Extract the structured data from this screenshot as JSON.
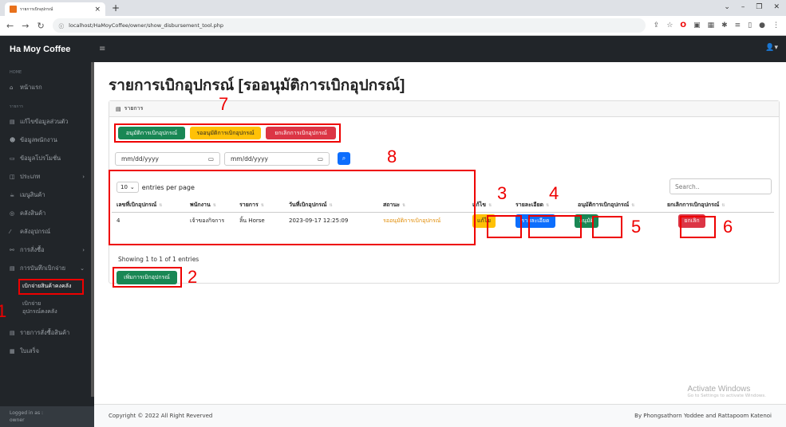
{
  "browser": {
    "tab_title": "รายการเบิกอุปกรณ์",
    "url": "localhost/HaMoyCoffee/owner/show_disbursement_tool.php"
  },
  "app": {
    "brand": "Ha Moy Coffee",
    "logged_in_label": "Logged in as :",
    "logged_in_user": "owner"
  },
  "sidebar": {
    "section_home": "HOME",
    "home": "หน้าแรก",
    "section_list": "รายการ",
    "items": [
      {
        "label": "แก้ไขข้อมูลส่วนตัว",
        "icon": "id-card-icon"
      },
      {
        "label": "ข้อมูลพนักงาน",
        "icon": "users-icon"
      },
      {
        "label": "ข้อมูลโปรโมชั่น",
        "icon": "tag-icon"
      },
      {
        "label": "ประเภท",
        "icon": "grid-icon"
      },
      {
        "label": "เมนูสินค้า",
        "icon": "cup-icon"
      },
      {
        "label": "คลังสินค้า",
        "icon": "box-icon"
      },
      {
        "label": "คลังอุปกรณ์",
        "icon": "tools-icon"
      },
      {
        "label": "การสั่งซื้อ",
        "icon": "cart-icon"
      },
      {
        "label": "การบันทึกเบิกจ่าย",
        "icon": "list-icon"
      }
    ],
    "sub_items": [
      "เบิกจ่ายสินค้าคงคลัง",
      "เบิกจ่ายอุปกรณ์คงคลัง"
    ],
    "items_after": [
      {
        "label": "รายการสั่งซื้อสินค้า",
        "icon": "list-icon"
      },
      {
        "label": "ใบเสร็จ",
        "icon": "receipt-icon"
      }
    ]
  },
  "page": {
    "title": "รายการเบิกอุปกรณ์ [รออนุมัติการเบิกอุปกรณ์]",
    "card_header": "รายการ",
    "filter_buttons": {
      "approved": "อนุมัติการเบิกอุปกรณ์",
      "pending": "รออนุมัติการเบิกอุปกรณ์",
      "cancelled": "ยกเลิกการเบิกอุปกรณ์"
    },
    "date_from_placeholder": "mm/dd/yyyy",
    "date_to_placeholder": "mm/dd/yyyy",
    "entries_value": "10",
    "entries_label": "entries per page",
    "search_placeholder": "Search..",
    "table": {
      "headers": [
        "เลขที่เบิกอุปกรณ์",
        "พนักงาน",
        "รายการ",
        "วันที่เบิกอุปกรณ์",
        "สถานะ",
        "แก้ไข",
        "รายละเอียด",
        "อนุมัติการเบิกอุปกรณ์",
        "ยกเลิกการเบิกอุปกรณ์"
      ],
      "rows": [
        {
          "id": "4",
          "employee": "เจ้าของกิจการ",
          "item": "ลิ้น Horse",
          "date": "2023-09-17 12:25:09",
          "status": "รออนุมัติการเบิกอุปกรณ์",
          "edit": "แก้ไข",
          "detail": "รายละเอียด",
          "approve": "อนุมัติ",
          "cancel": "ยกเลิก"
        }
      ]
    },
    "showing": "Showing 1 to 1 of 1 entries",
    "add_button": "เพิ่มการเบิกอุปกรณ์"
  },
  "annotations": {
    "n1": "1",
    "n2": "2",
    "n3": "3",
    "n4": "4",
    "n5": "5",
    "n6": "6",
    "n7": "7",
    "n8": "8"
  },
  "footer": {
    "copyright": "Copyright © 2022 All Right Reverved",
    "credit": "By Phongsathorn Yoddee and Rattapoom Katenoi"
  },
  "watermark": {
    "line1": "Activate Windows",
    "line2": "Go to Settings to activate Windows."
  },
  "colors": {
    "accent_red": "#e00000",
    "success": "#198754",
    "warning": "#ffc107",
    "danger": "#dc3545",
    "primary": "#0d6efd"
  }
}
